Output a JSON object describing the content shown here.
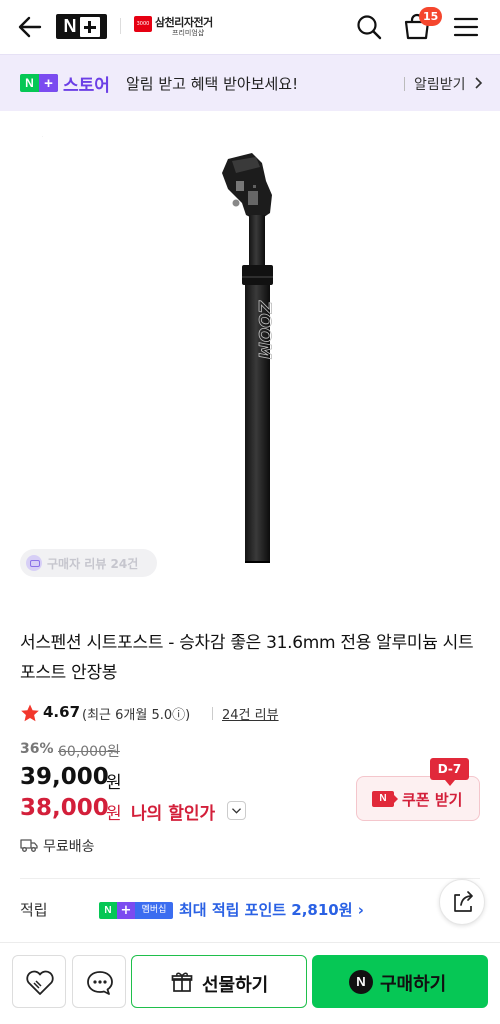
{
  "header": {
    "cart_count": "15",
    "brand_name": "삼천리자전거",
    "brand_sub": "프리미엄샵",
    "icons": [
      "back-arrow-icon",
      "naver-plus-logo",
      "search-icon",
      "cart-icon",
      "hamburger-menu-icon"
    ]
  },
  "store_banner": {
    "store_label": "스토어",
    "message": "알림 받고 혜택 받아보세요!",
    "action": "알림받기"
  },
  "gallery": {
    "review_chip": "구매자 리뷰 24건",
    "product_image": "black-suspension-seatpost"
  },
  "product": {
    "title": "서스펜션 시트포스트 - 승차감 좋은 31.6mm 전용 알루미늄 시트포스트 안장봉"
  },
  "rating": {
    "score": "4.67",
    "recent": "(최근 6개월 5.0ⓘ)",
    "reviews_link": "24건 리뷰"
  },
  "price": {
    "discount": "36%",
    "original": "60,000원",
    "current": "39,000",
    "unit": "원",
    "my_price": "38,000",
    "my_price_label": "나의 할인가"
  },
  "coupon": {
    "dday": "D-7",
    "label": "쿠폰 받기"
  },
  "shipping": {
    "label": "무료배송"
  },
  "points": {
    "label": "적립",
    "badge_text": "멤버십",
    "text": "최대 적립 포인트 2,810원 ›"
  },
  "bottom_bar": {
    "gift_label": "선물하기",
    "buy_label": "구매하기"
  },
  "colors": {
    "naver_green": "#06c755",
    "plus_purple": "#7b4cf0",
    "discount_red": "#d31f3a",
    "points_blue": "#2a61e4"
  }
}
